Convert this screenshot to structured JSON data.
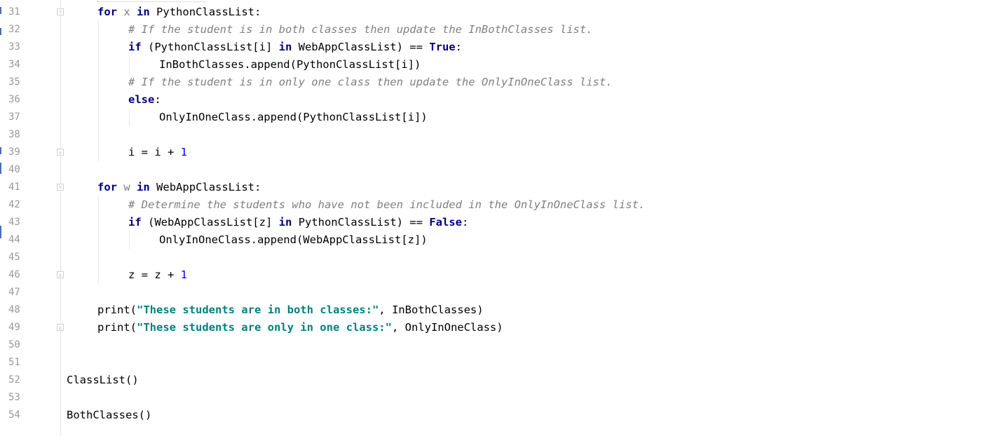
{
  "editor": {
    "lines": [
      {
        "n": "31",
        "indent": 1,
        "fold": "open",
        "parts": [
          {
            "t": "for",
            "c": "kw"
          },
          {
            "t": " "
          },
          {
            "t": "x",
            "c": "unused"
          },
          {
            "t": " "
          },
          {
            "t": "in",
            "c": "kw"
          },
          {
            "t": " PythonClassList:"
          }
        ]
      },
      {
        "n": "32",
        "indent": 2,
        "parts": [
          {
            "t": "# If the student is in both classes then update the InBothClasses list.",
            "c": "cmt"
          }
        ]
      },
      {
        "n": "33",
        "indent": 2,
        "parts": [
          {
            "t": "if",
            "c": "kw"
          },
          {
            "t": " (PythonClassList[i] "
          },
          {
            "t": "in",
            "c": "kw"
          },
          {
            "t": " WebAppClassList) == "
          },
          {
            "t": "True",
            "c": "kw"
          },
          {
            "t": ":"
          }
        ]
      },
      {
        "n": "34",
        "indent": 3,
        "parts": [
          {
            "t": "InBothClasses.append(PythonClassList[i])"
          }
        ]
      },
      {
        "n": "35",
        "indent": 2,
        "parts": [
          {
            "t": "# If the student is in only one class then update the OnlyInOneClass list.",
            "c": "cmt"
          }
        ]
      },
      {
        "n": "36",
        "indent": 2,
        "parts": [
          {
            "t": "else",
            "c": "kw"
          },
          {
            "t": ":"
          }
        ]
      },
      {
        "n": "37",
        "indent": 3,
        "parts": [
          {
            "t": "OnlyInOneClass.append(PythonClassList[i])"
          }
        ]
      },
      {
        "n": "38",
        "indent": 0,
        "parts": []
      },
      {
        "n": "39",
        "indent": 2,
        "fold": "close",
        "parts": [
          {
            "t": "i = i + "
          },
          {
            "t": "1",
            "c": "num"
          }
        ]
      },
      {
        "n": "40",
        "indent": 0,
        "parts": []
      },
      {
        "n": "41",
        "indent": 1,
        "fold": "open",
        "parts": [
          {
            "t": "for",
            "c": "kw"
          },
          {
            "t": " "
          },
          {
            "t": "w",
            "c": "unused"
          },
          {
            "t": " "
          },
          {
            "t": "in",
            "c": "kw"
          },
          {
            "t": " WebAppClassList:"
          }
        ]
      },
      {
        "n": "42",
        "indent": 2,
        "parts": [
          {
            "t": "# Determine the students who have not been included in the OnlyInOneClass list.",
            "c": "cmt"
          }
        ]
      },
      {
        "n": "43",
        "indent": 2,
        "parts": [
          {
            "t": "if",
            "c": "kw"
          },
          {
            "t": " (WebAppClassList[z] "
          },
          {
            "t": "in",
            "c": "kw"
          },
          {
            "t": " PythonClassList) == "
          },
          {
            "t": "False",
            "c": "kw"
          },
          {
            "t": ":"
          }
        ]
      },
      {
        "n": "44",
        "indent": 3,
        "parts": [
          {
            "t": "OnlyInOneClass.append(WebAppClassList[z])"
          }
        ]
      },
      {
        "n": "45",
        "indent": 0,
        "parts": []
      },
      {
        "n": "46",
        "indent": 2,
        "fold": "close",
        "parts": [
          {
            "t": "z = z + "
          },
          {
            "t": "1",
            "c": "num"
          }
        ]
      },
      {
        "n": "47",
        "indent": 0,
        "parts": []
      },
      {
        "n": "48",
        "indent": 1,
        "parts": [
          {
            "t": "print("
          },
          {
            "t": "\"These students are in both classes:\"",
            "c": "str"
          },
          {
            "t": ", InBothClasses)"
          }
        ]
      },
      {
        "n": "49",
        "indent": 1,
        "fold": "close",
        "parts": [
          {
            "t": "print("
          },
          {
            "t": "\"These students are only in one class:\"",
            "c": "str"
          },
          {
            "t": ", OnlyInOneClass)"
          }
        ]
      },
      {
        "n": "50",
        "indent": 0,
        "parts": []
      },
      {
        "n": "51",
        "indent": 0,
        "parts": []
      },
      {
        "n": "52",
        "indent": 0,
        "parts": [
          {
            "t": "ClassList()"
          }
        ]
      },
      {
        "n": "53",
        "indent": 0,
        "parts": []
      },
      {
        "n": "54",
        "indent": 0,
        "parts": [
          {
            "t": "BothClasses()"
          }
        ]
      }
    ]
  },
  "colors": {
    "keyword": "#000080",
    "comment": "#808080",
    "string": "#008080",
    "number": "#0000ff",
    "line_number": "#999999"
  }
}
